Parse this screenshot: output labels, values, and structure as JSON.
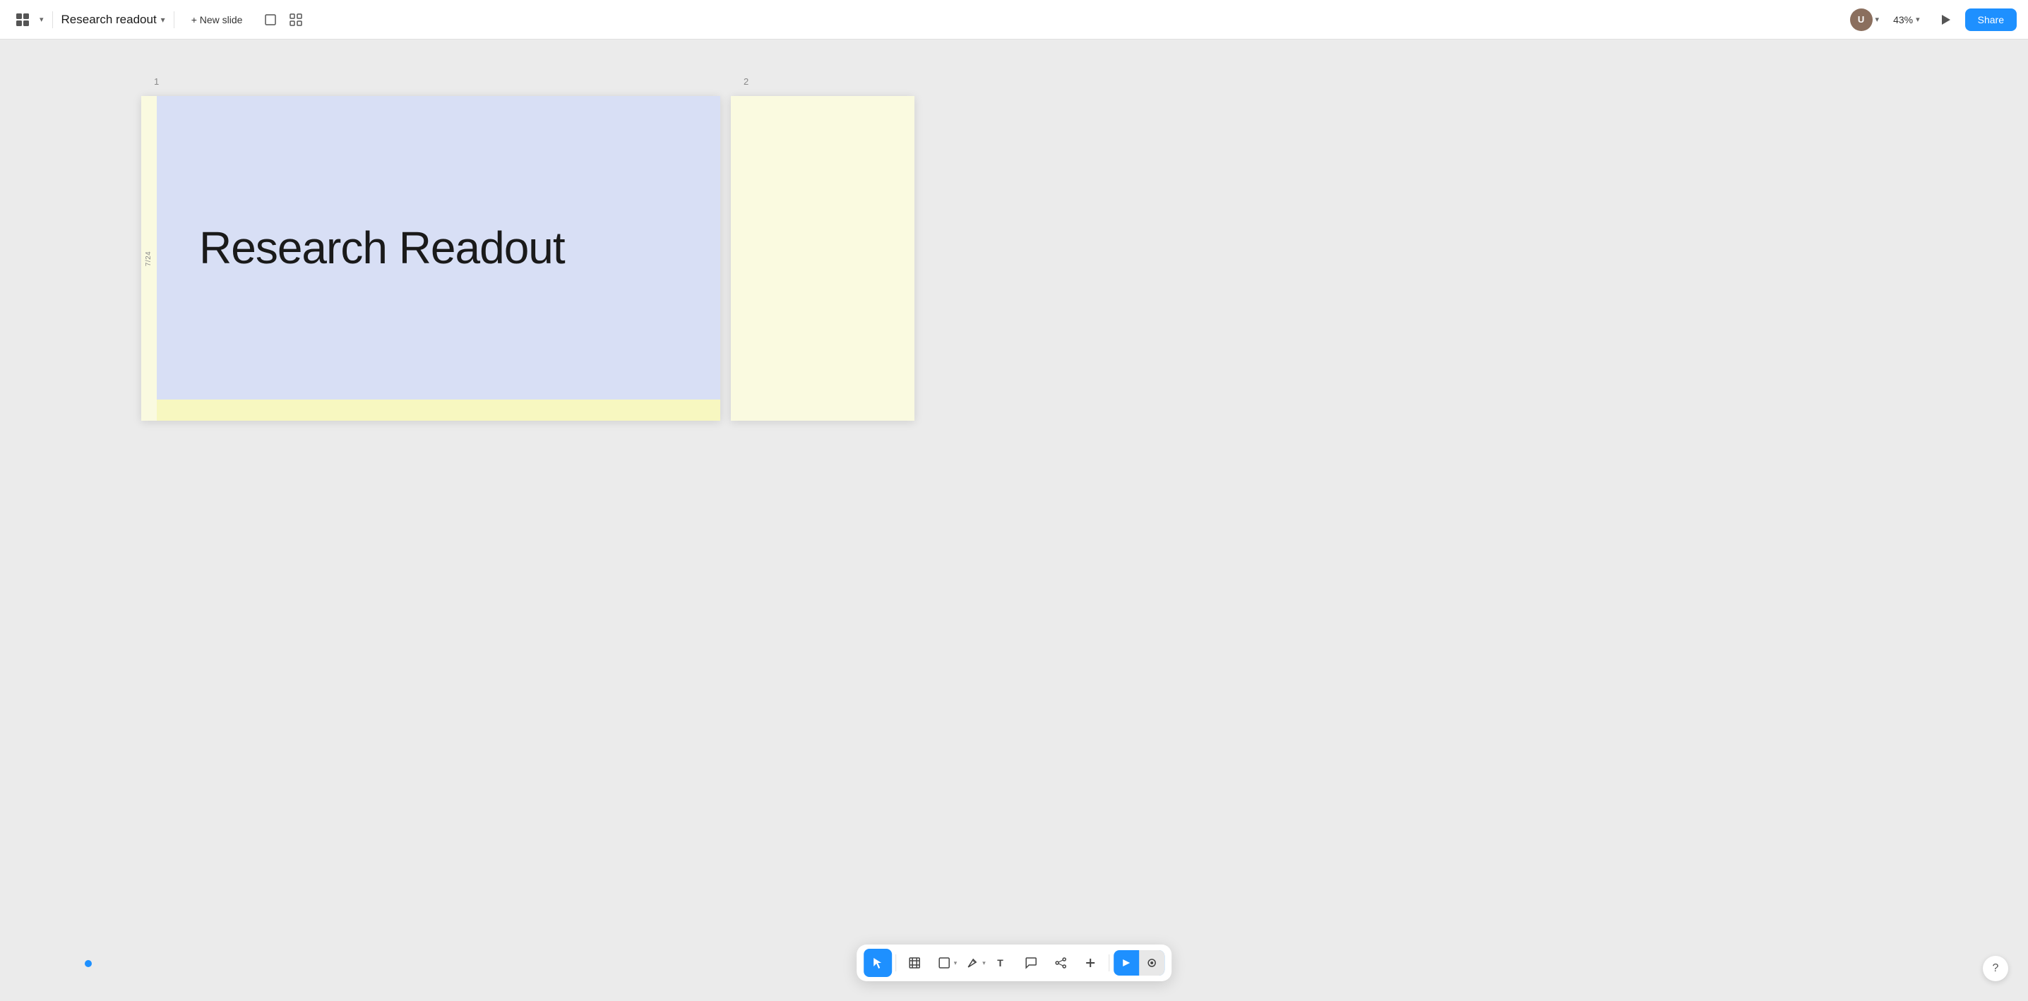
{
  "app": {
    "icon_label": "grid-app-icon",
    "title": "Research readout",
    "title_chevron": "▾"
  },
  "toolbar": {
    "new_slide_label": "+ New slide",
    "view_single_label": "single-view",
    "view_grid_label": "grid-view"
  },
  "topbar_right": {
    "zoom_value": "43%",
    "zoom_chevron": "▾",
    "share_label": "Share"
  },
  "slides": [
    {
      "number": "1",
      "label": "7/24",
      "title": "Research Readout",
      "bg_color": "#d8dff5",
      "strip_color": "#fafae0",
      "bottom_color": "#f7f7c0"
    },
    {
      "number": "2",
      "bg_color": "#fafae0",
      "strip_color": "#fafae0"
    }
  ],
  "bottom_toolbar": {
    "select_label": "select-tool",
    "grid_label": "grid-tool",
    "shape_label": "shape-tool",
    "pen_label": "pen-tool",
    "text_label": "text-tool",
    "chat_label": "chat-tool",
    "nodes_label": "nodes-tool",
    "add_label": "add-tool",
    "toggle_left_label": "toggle-left",
    "toggle_right_label": "toggle-right"
  },
  "help": {
    "label": "?"
  }
}
